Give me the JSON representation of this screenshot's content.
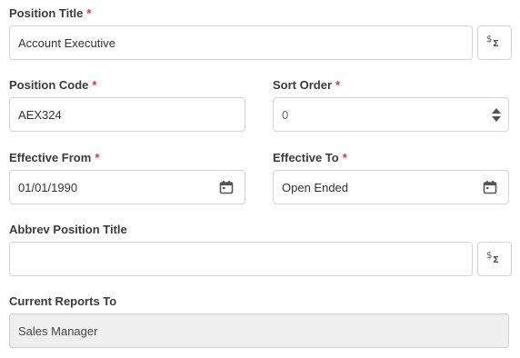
{
  "form": {
    "position_title": {
      "label": "Position Title",
      "required_mark": "*",
      "value": "Account Executive",
      "action_icon": "translate-sigma-icon"
    },
    "position_code": {
      "label": "Position Code",
      "required_mark": "*",
      "value": "AEX324"
    },
    "sort_order": {
      "label": "Sort Order",
      "required_mark": "*",
      "value": "0",
      "control_icon": "spinner-updown-icon"
    },
    "effective_from": {
      "label": "Effective From",
      "required_mark": "*",
      "value": "01/01/1990",
      "control_icon": "calendar-icon"
    },
    "effective_to": {
      "label": "Effective To",
      "required_mark": "*",
      "value": "Open Ended",
      "control_icon": "calendar-icon"
    },
    "abbrev_position_title": {
      "label": "Abbrev Position Title",
      "value": "",
      "action_icon": "translate-sigma-icon"
    },
    "current_reports_to": {
      "label": "Current Reports To",
      "value": "Sales Manager"
    }
  },
  "colors": {
    "required": "#d9363e",
    "border": "#d4d4d4",
    "readonly_bg": "#efefef",
    "icon": "#555555"
  }
}
